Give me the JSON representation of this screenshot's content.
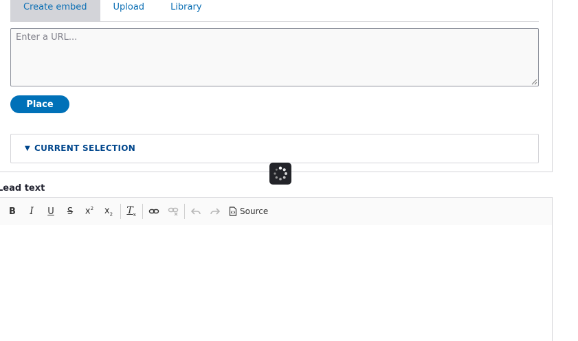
{
  "tabs": [
    {
      "label": "Create embed",
      "active": true
    },
    {
      "label": "Upload",
      "active": false
    },
    {
      "label": "Library",
      "active": false
    }
  ],
  "url_input": {
    "placeholder": "Enter a URL...",
    "value": ""
  },
  "place_button": {
    "label": "Place"
  },
  "current_selection": {
    "label": "CURRENT SELECTION",
    "expanded": true
  },
  "lead_text": {
    "label": "Lead text"
  },
  "toolbar": {
    "buttons": [
      {
        "name": "bold",
        "glyph": "B"
      },
      {
        "name": "italic",
        "glyph": "I"
      },
      {
        "name": "underline",
        "glyph": "U"
      },
      {
        "name": "strikethrough",
        "glyph": "S"
      },
      {
        "name": "superscript",
        "glyph": "x²"
      },
      {
        "name": "subscript",
        "glyph": "x₂"
      },
      {
        "name": "remove-format",
        "glyph": "Tx"
      },
      {
        "name": "link",
        "glyph": "link"
      },
      {
        "name": "unlink",
        "glyph": "unlink",
        "disabled": true
      },
      {
        "name": "undo",
        "glyph": "undo",
        "disabled": true
      },
      {
        "name": "redo",
        "glyph": "redo",
        "disabled": true
      }
    ],
    "source_label": "Source"
  },
  "colors": {
    "accent": "#0071b8",
    "link": "#0a6eb4",
    "summary": "#00468c"
  }
}
